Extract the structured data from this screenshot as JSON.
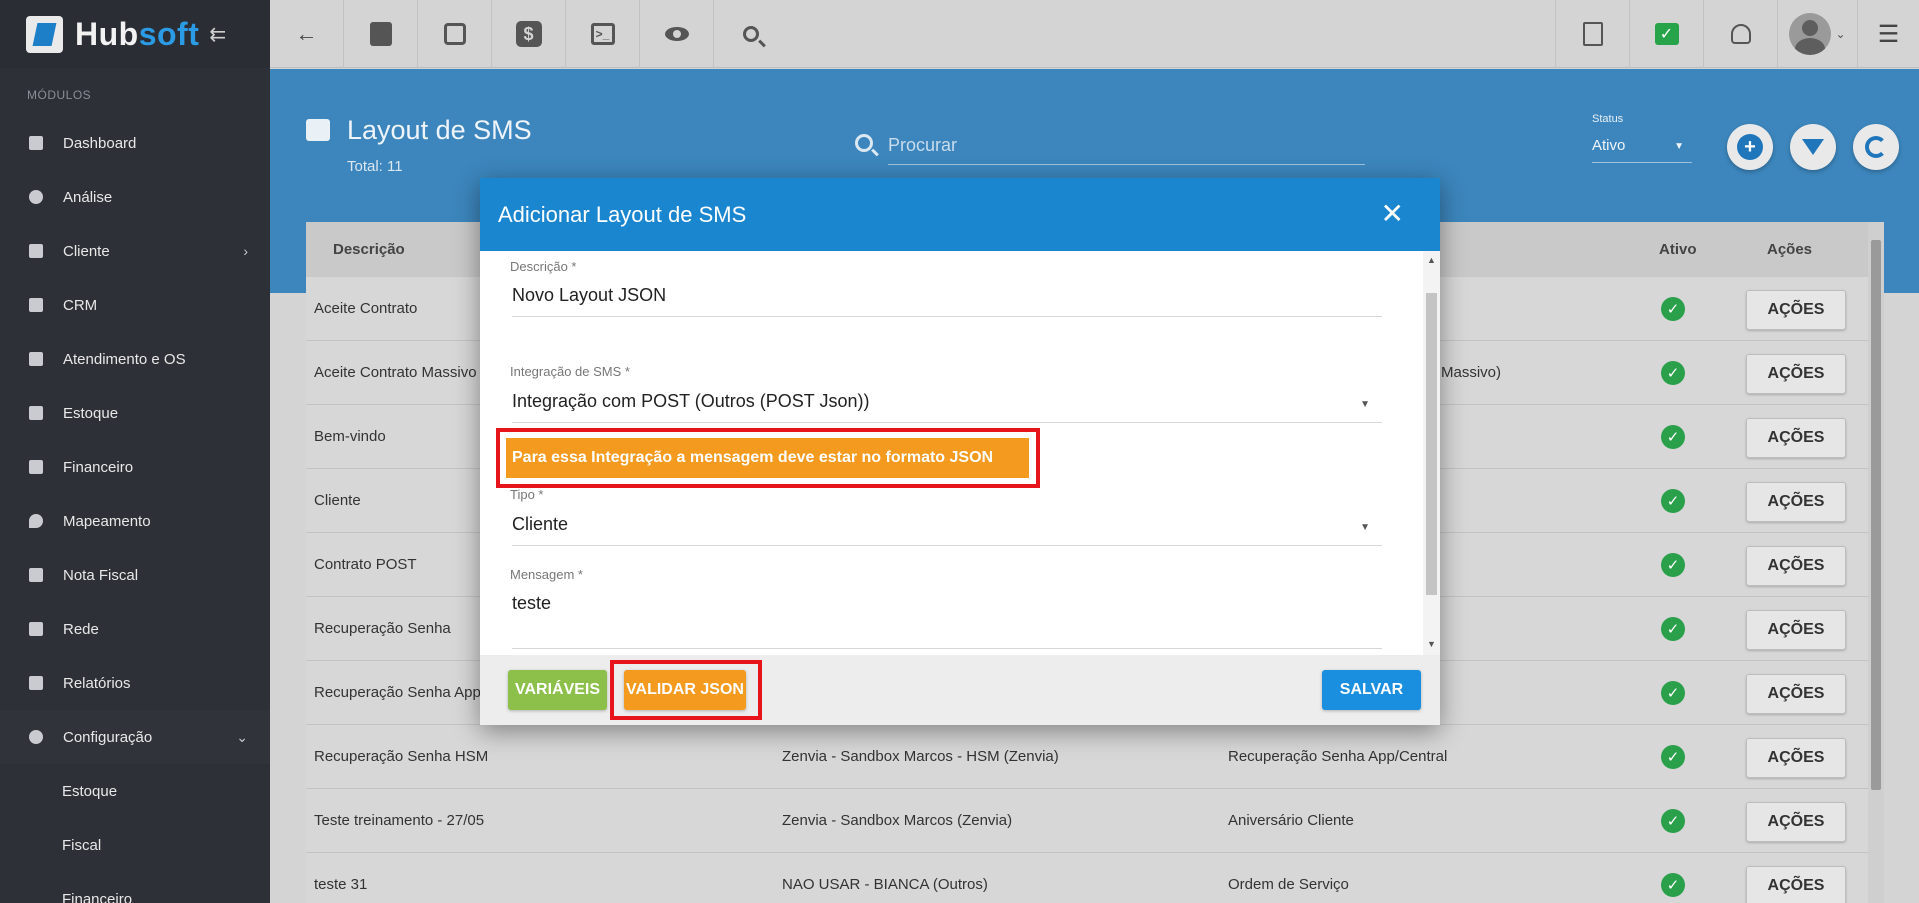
{
  "brand": {
    "name_part1": "Hub",
    "name_part2": "soft",
    "collapse_glyph": "⇇"
  },
  "sidebar": {
    "section_label": "MÓDULOS",
    "items": [
      {
        "label": "Dashboard",
        "icon": "grid-icon"
      },
      {
        "label": "Análise",
        "icon": "chart-pie-icon"
      },
      {
        "label": "Cliente",
        "icon": "contact-card-icon",
        "has_children": true
      },
      {
        "label": "CRM",
        "icon": "board-icon"
      },
      {
        "label": "Atendimento e OS",
        "icon": "calendar-clock-icon"
      },
      {
        "label": "Estoque",
        "icon": "box-icon"
      },
      {
        "label": "Financeiro",
        "icon": "money-icon"
      },
      {
        "label": "Mapeamento",
        "icon": "map-pin-icon"
      },
      {
        "label": "Nota Fiscal",
        "icon": "document-icon"
      },
      {
        "label": "Rede",
        "icon": "server-icon"
      },
      {
        "label": "Relatórios",
        "icon": "report-icon"
      },
      {
        "label": "Configuração",
        "icon": "gear-icon",
        "expanded": true
      }
    ],
    "subitems": [
      "Estoque",
      "Fiscal",
      "Financeiro"
    ]
  },
  "topbar": {
    "icons": [
      "back-arrow-icon",
      "contact-card-icon",
      "calendar-clock-icon",
      "dollar-icon",
      "terminal-icon",
      "eye-icon",
      "search-icon"
    ],
    "right_icons": [
      "pdf-icon",
      "task-check-icon",
      "bell-icon",
      "avatar",
      "list-menu-icon"
    ]
  },
  "page": {
    "title": "Layout de SMS",
    "total": "Total: 11",
    "search_placeholder": "Procurar",
    "status_label": "Status",
    "status_value": "Ativo"
  },
  "table": {
    "headers": {
      "descricao": "Descrição",
      "ativo": "Ativo",
      "acoes": "Ações"
    },
    "action_label": "AÇÕES",
    "rows": [
      {
        "descricao": "Aceite Contrato",
        "integracao": "",
        "tipo": ""
      },
      {
        "descricao": "Aceite Contrato Massivo",
        "integracao": "",
        "tipo": "Massivo)"
      },
      {
        "descricao": "Bem-vindo",
        "integracao": "",
        "tipo": ""
      },
      {
        "descricao": "Cliente",
        "integracao": "",
        "tipo": ""
      },
      {
        "descricao": "Contrato POST",
        "integracao": "",
        "tipo": ""
      },
      {
        "descricao": "Recuperação Senha",
        "integracao": "",
        "tipo": ""
      },
      {
        "descricao": "Recuperação Senha App/C",
        "integracao": "",
        "tipo": ""
      },
      {
        "descricao": "Recuperação Senha HSM",
        "integracao": "Zenvia - Sandbox Marcos - HSM (Zenvia)",
        "tipo": "Recuperação Senha App/Central"
      },
      {
        "descricao": "Teste treinamento - 27/05",
        "integracao": "Zenvia - Sandbox Marcos (Zenvia)",
        "tipo": "Aniversário Cliente"
      },
      {
        "descricao": "teste 31",
        "integracao": "NAO USAR - BIANCA (Outros)",
        "tipo": "Ordem de Serviço"
      }
    ]
  },
  "modal": {
    "title": "Adicionar Layout de SMS",
    "descricao_label": "Descrição *",
    "descricao_value": "Novo Layout JSON",
    "integracao_label": "Integração de SMS *",
    "integracao_value": "Integração com POST (Outros (POST Json))",
    "warning": "Para essa Integração a mensagem deve estar no formato JSON",
    "tipo_label": "Tipo *",
    "tipo_value": "Cliente",
    "mensagem_label": "Mensagem *",
    "mensagem_value": "teste",
    "btn_variaveis": "VARIÁVEIS",
    "btn_validar": "VALIDAR JSON",
    "btn_salvar": "SALVAR"
  },
  "colors": {
    "sidebar_bg": "#2d3036",
    "header_blue": "#3c86bd",
    "modal_header": "#1a86cf",
    "warning_orange": "#f39a1f",
    "highlight_red": "#e8141b",
    "green": "#8cc04a",
    "save_blue": "#1a8fe0",
    "active_green": "#2aa04a"
  }
}
